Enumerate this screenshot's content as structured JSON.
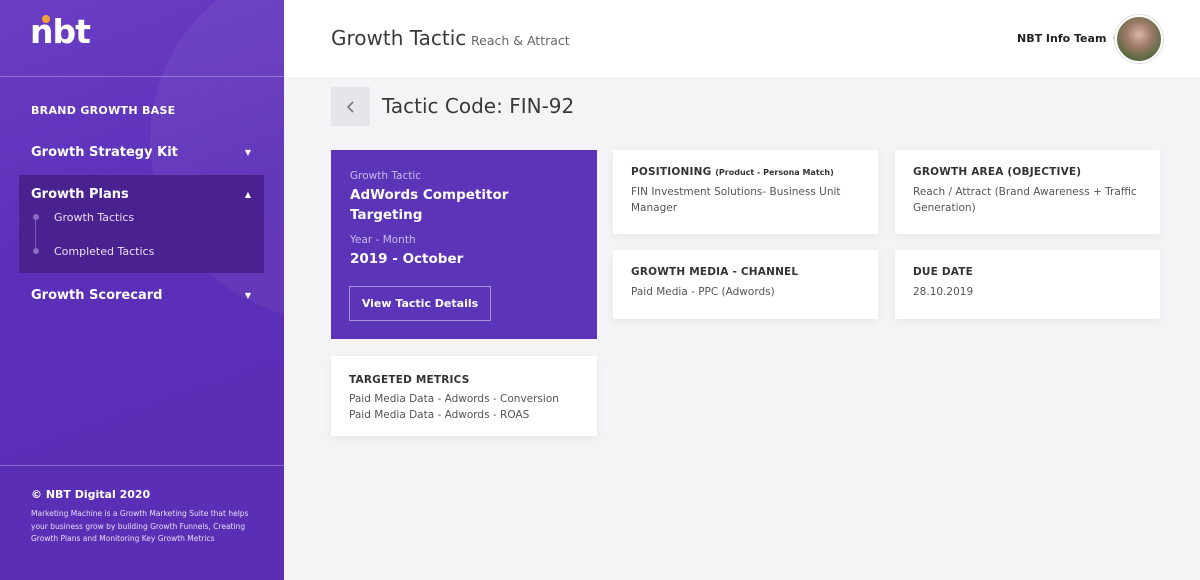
{
  "sidebar": {
    "logo_text": "nbt",
    "section_title": "BRAND GROWTH BASE",
    "items": [
      {
        "label": "Growth Strategy Kit"
      },
      {
        "label": "Growth Plans"
      },
      {
        "label": "Growth Scorecard"
      }
    ],
    "sub_items": [
      {
        "label": "Growth Tactics"
      },
      {
        "label": "Completed Tactics"
      }
    ],
    "copyright": "© NBT Digital 2020",
    "footer_text": "Marketing Machine is a Growth Marketing Suite that helps your business grow by building Growth Funnels, Creating Growth Plans and Monitoring Key Growth Metrics"
  },
  "header": {
    "title": "Growth Tactic",
    "subtitle": "Reach & Attract",
    "user_name": "NBT Info Team"
  },
  "main": {
    "tactic_code": "Tactic Code: FIN-92",
    "summary": {
      "tactic_label": "Growth Tactic",
      "tactic_value": "AdWords Competitor Targeting",
      "period_label": "Year - Month",
      "period_value": "2019 - October",
      "button_label": "View Tactic Details"
    },
    "metrics": {
      "title": "TARGETED METRICS",
      "lines": [
        "Paid Media Data - Adwords - Conversion",
        "Paid Media Data - Adwords - ROAS"
      ]
    },
    "positioning": {
      "title": "POSITIONING",
      "title_note": "(Product - Persona Match)",
      "value": "FIN Investment Solutions- Business Unit Manager"
    },
    "growth_area": {
      "title": "GROWTH AREA (OBJECTIVE)",
      "value": "Reach / Attract (Brand Awareness + Traffic Generation)"
    },
    "channel": {
      "title": "GROWTH MEDIA - CHANNEL",
      "value": "Paid Media - PPC (Adwords)"
    },
    "due_date": {
      "title": "DUE DATE",
      "value": "28.10.2019"
    }
  },
  "colors": {
    "sidebar": "#5b2fb8",
    "accent_card": "#5b34b8",
    "logo_dot": "#f2a33a"
  },
  "icons": {
    "back": "chevron-left-icon",
    "dropdown": "caret-down-icon",
    "collapse": "caret-up-icon"
  }
}
